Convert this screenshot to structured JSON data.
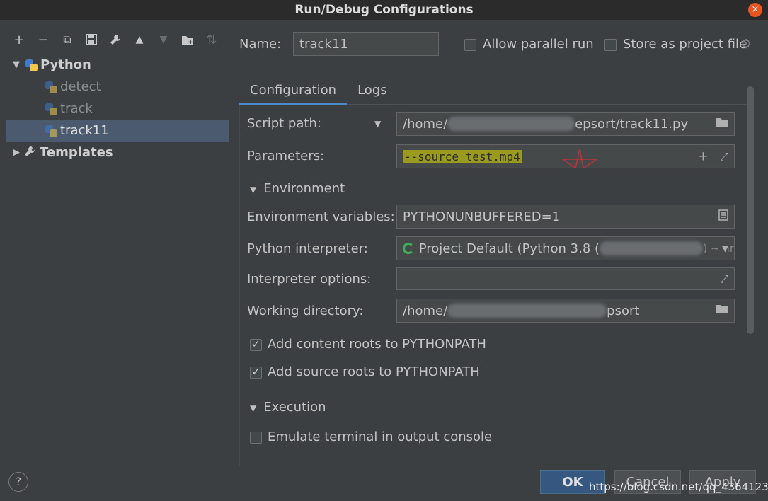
{
  "window": {
    "title": "Run/Debug Configurations",
    "close_glyph": "×"
  },
  "toolbar": [
    "+",
    "−",
    "⧉",
    "💾",
    "🔧",
    "▲",
    "▼",
    "📁",
    "⇅"
  ],
  "tree": {
    "python_label": "Python",
    "children": [
      "detect",
      "track",
      "track11"
    ],
    "templates_label": "Templates"
  },
  "header": {
    "name_label": "Name:",
    "name_value": "track11",
    "allow_parallel": "Allow parallel run",
    "store_project": "Store as project file"
  },
  "tabs": [
    "Configuration",
    "Logs"
  ],
  "form": {
    "script_path_label": "Script path:",
    "script_path_prefix": "/home/",
    "script_path_suffix": "epsort/track11.py",
    "parameters_label": "Parameters:",
    "parameters_value": "--source test.mp4",
    "environment_section": "Environment",
    "env_vars_label": "Environment variables:",
    "env_vars_value": "PYTHONUNBUFFERED=1",
    "interpreter_label": "Python interpreter:",
    "interpreter_value": "Project Default (Python 3.8 (",
    "interpreter_suffix": ") ~/ar",
    "interp_options_label": "Interpreter options:",
    "working_dir_label": "Working directory:",
    "working_dir_prefix": "/home/",
    "working_dir_suffix": "psort",
    "content_roots": "Add content roots to PYTHONPATH",
    "source_roots": "Add source roots to PYTHONPATH",
    "execution_section": "Execution",
    "emulate_terminal": "Emulate terminal in output console"
  },
  "buttons": {
    "ok": "OK",
    "cancel": "Cancel",
    "apply": "Apply",
    "help": "?"
  },
  "watermark": "https://blog.csdn.net/qq_43641239"
}
